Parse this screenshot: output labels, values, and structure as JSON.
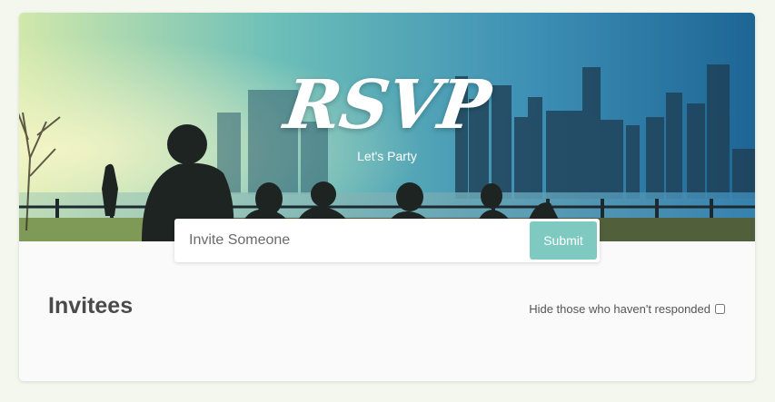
{
  "header": {
    "title": "RSVP",
    "subtitle": "Let's Party"
  },
  "invite_form": {
    "input_placeholder": "Invite Someone",
    "input_value": "",
    "submit_label": "Submit"
  },
  "invitees": {
    "heading": "Invitees",
    "filter_label": "Hide those who haven't responded",
    "filter_checked": false
  },
  "colors": {
    "background": "#f3f7ee",
    "card": "#fafafa",
    "submit_button": "#7ec9c0",
    "hero_gradient_left": "#c9e4a6",
    "hero_gradient_right": "#1e6a96"
  },
  "icons": {
    "hero_image": "city-skyline-photo"
  }
}
